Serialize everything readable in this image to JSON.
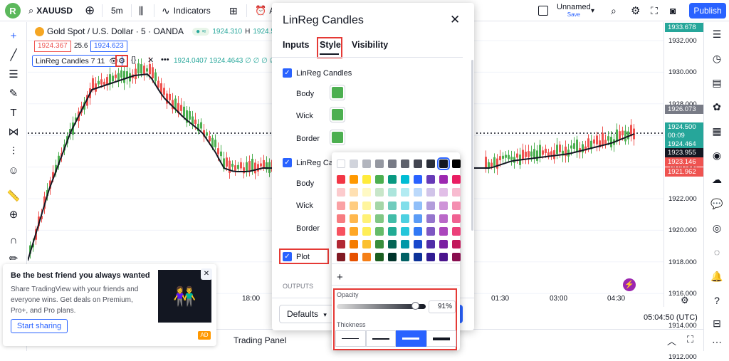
{
  "topbar": {
    "logo": "R",
    "symbol": "XAUUSD",
    "interval": "5m",
    "indicators_label": "Indicators",
    "alert_label": "A",
    "layout_name": "Unnamed",
    "layout_status": "Save",
    "publish_label": "Publish"
  },
  "legend": {
    "title": "Gold Spot / U.S. Dollar · 5 · OANDA",
    "price": "1924.310",
    "h_label": "H",
    "h_value": "1924.545",
    "sell": "1924.367",
    "spread": "25.6",
    "buy": "1924.623",
    "indicator_name": "LinReg Candles 7 11",
    "indicator_values": "1924.0407  1924.4643  ∅  ∅  ∅  ∅  ∅  ∅"
  },
  "price_axis": {
    "ticks": [
      "1932.000",
      "1930.000",
      "1928.000",
      "1926.000",
      "1924.000",
      "1922.000",
      "1920.000",
      "1918.000",
      "1916.000",
      "1914.000",
      "1912.000"
    ],
    "labels": [
      {
        "text": "1933.678",
        "color": "#26a69a"
      },
      {
        "text": "1926.073",
        "color": "#787b86"
      },
      {
        "text": "1924.500",
        "color": "#26a69a"
      },
      {
        "text": "00:09",
        "color": "#26a69a"
      },
      {
        "text": "1924.464",
        "color": "#26a69a"
      },
      {
        "text": "1923.955",
        "color": "#131722"
      },
      {
        "text": "1923.146",
        "color": "#ef5350"
      },
      {
        "text": "1921.962",
        "color": "#ef5350"
      }
    ]
  },
  "time_axis": {
    "ticks": [
      "18:00",
      "01:30",
      "03:00",
      "04:30"
    ],
    "clock": "05:04:50 (UTC)"
  },
  "bottom": {
    "trading_panel": "Trading Panel"
  },
  "dialog": {
    "title": "LinReg Candles",
    "tabs": [
      "Inputs",
      "Style",
      "Visibility"
    ],
    "active_tab": "Style",
    "group1_label": "LinReg Candles",
    "group2_label": "LinReg Ca",
    "rows": [
      "Body",
      "Wick",
      "Border"
    ],
    "rows2": [
      "Body",
      "Wick",
      "Border"
    ],
    "plot_label": "Plot",
    "outputs_label": "OUTPUTS",
    "defaults_label": "Defaults",
    "swatch_color": "#4caf50"
  },
  "color_popup": {
    "opacity_label": "Opacity",
    "opacity_value": "91%",
    "thickness_label": "Thickness",
    "add_label": "+",
    "thickness_selected": 3
  },
  "ad": {
    "title": "Be the best friend you always wanted",
    "body": "Share TradingView with your friends and everyone wins. Get deals on Premium, Pro+, and Pro plans.",
    "button": "Start sharing",
    "badge": "AD"
  }
}
